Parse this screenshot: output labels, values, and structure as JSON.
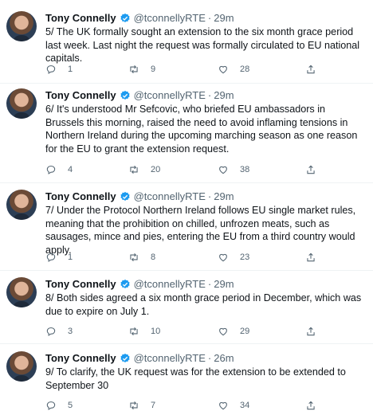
{
  "tweets": [
    {
      "name": "Tony Connelly",
      "handle": "@tconnellyRTE",
      "sep": "·",
      "time": "29m",
      "text": "5/ The UK formally sought an extension to the six month grace period last week.  Last night the request was formally circulated to EU national capitals.",
      "replies": "1",
      "retweets": "9",
      "likes": "28"
    },
    {
      "name": "Tony Connelly",
      "handle": "@tconnellyRTE",
      "sep": "·",
      "time": "29m",
      "text": "6/ It's understood Mr Sefcovic, who briefed EU ambassadors in Brussels this morning, raised the need to avoid inflaming tensions in Northern Ireland during the upcoming marching season as one reason for the EU to grant the extension request.",
      "replies": "4",
      "retweets": "20",
      "likes": "38"
    },
    {
      "name": "Tony Connelly",
      "handle": "@tconnellyRTE",
      "sep": "·",
      "time": "29m",
      "text": "7/ Under the Protocol Northern Ireland follows EU single market rules, meaning that the prohibition on chilled, unfrozen meats, such as sausages, mince and pies, entering the EU from a third country would apply.",
      "replies": "1",
      "retweets": "8",
      "likes": "23"
    },
    {
      "name": "Tony Connelly",
      "handle": "@tconnellyRTE",
      "sep": "·",
      "time": "29m",
      "text": "8/ Both sides agreed a six month grace period in December, which was due to expire on July 1.",
      "replies": "3",
      "retweets": "10",
      "likes": "29"
    },
    {
      "name": "Tony Connelly",
      "handle": "@tconnellyRTE",
      "sep": "·",
      "time": "26m",
      "text": "9/ To clarify, the UK request was for the extension to be extended to September 30",
      "replies": "5",
      "retweets": "7",
      "likes": "34"
    }
  ],
  "colors": {
    "verified": "#1d9bf0",
    "muted": "#536471",
    "text": "#0f1419",
    "divider": "#eff3f4"
  },
  "icons": [
    "verified-badge-icon",
    "reply-icon",
    "retweet-icon",
    "like-icon",
    "share-icon"
  ]
}
